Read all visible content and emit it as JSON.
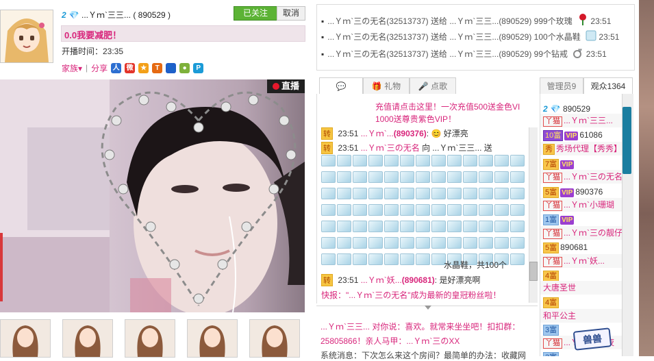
{
  "host": {
    "level_badge": "2",
    "name": "...Ｙｍ`三三...",
    "room_id": "( 890529 )",
    "follow_label": "已关注",
    "cancel_label": "取消",
    "title": "0.0我要减肥！",
    "airtime_label": "开播时间：23:35",
    "family_label": "家族▾",
    "share_label": "分享"
  },
  "video": {
    "live_label": "直播"
  },
  "gift_feed": [
    {
      "text": "...Ｙｍ`三の无名(32513737) 送给 ...Ｙｍ`三三...(890529) 999个玫瑰",
      "time": "23:51",
      "icon": "rose-icon"
    },
    {
      "text": "...Ｙｍ`三の无名(32513737) 送给 ...Ｙｍ`三三...(890529) 100个水晶鞋",
      "time": "23:51",
      "icon": "crystal-shoe-icon"
    },
    {
      "text": "...Ｙｍ`三の无名(32513737) 送给 ...Ｙｍ`三三...(890529) 99个钻戒",
      "time": "23:51",
      "icon": "diamond-ring-icon"
    }
  ],
  "tabs": {
    "gift": "礼物",
    "song": "点歌",
    "admin": "管理员9",
    "audience": "观众1364"
  },
  "chat": {
    "announce_1": "充值请点击这里！一次充值500送金色VI",
    "announce_2": "1000送尊贵紫色VIP！",
    "zhuan": "转",
    "line1_time": "23:51",
    "line1_user": "...Ｙｍ`...",
    "line1_id": "(890376)",
    "line1_msg": ": 😊 好漂亮",
    "line2_time": "23:51",
    "line2_user": "...Ｙｍ`三の无名",
    "line2_msg": "向 ...Ｙｍ`三三... 送",
    "shoes_caption": "水晶鞋，共100个",
    "line3_time": "23:51",
    "line3_user": "...Ｙｍ`妖...",
    "line3_id": "(890681)",
    "line3_msg": ": 是好漂亮啊",
    "news": "快报：\"...Ｙｍ`三の无名\"成为最新的皇冠粉丝啦！"
  },
  "private": {
    "line1": "...Ｙｍ`三三... 对你说：喜欢。就常来坐坐吧！扣扣群：",
    "line2": "25805866！亲人马甲：...Ｙｍ`三のXX",
    "line3": "系统消息：下次怎么来这个房间？最简单的办法：收藏网"
  },
  "audience": [
    {
      "badge": "2",
      "name": "890529",
      "style": "plain"
    },
    {
      "badge": "丫猫",
      "name": "...Ｙｍ`三三...",
      "style": "cat"
    },
    {
      "badge": "10富",
      "name": "61086",
      "style": "purple-vip"
    },
    {
      "badge": "秀",
      "name": "秀场代理【秀秀】",
      "style": "agent"
    },
    {
      "badge": "7富",
      "name": "",
      "style": "rich-vip"
    },
    {
      "badge": "丫猫",
      "name": "...Ｙｍ`三の无名",
      "style": "cat"
    },
    {
      "badge": "5富",
      "name": "890376",
      "style": "rich-vip"
    },
    {
      "badge": "丫猫",
      "name": "...Ｙｍ`小珊瑚",
      "style": "cat"
    },
    {
      "badge": "1富",
      "name": "",
      "style": "blue-vip"
    },
    {
      "badge": "丫猫",
      "name": "...Ｙｍ`三の靓仔",
      "style": "cat"
    },
    {
      "badge": "5富",
      "name": "890681",
      "style": "rich"
    },
    {
      "badge": "丫猫",
      "name": "...Ｙｍ`妖...",
      "style": "cat"
    },
    {
      "badge": "4富",
      "name": "",
      "style": "rich"
    },
    {
      "badge": "",
      "name": "大唐圣世",
      "style": "plain-pink"
    },
    {
      "badge": "4富",
      "name": "",
      "style": "rich"
    },
    {
      "badge": "",
      "name": "和平公主",
      "style": "plain-pink"
    },
    {
      "badge": "3富",
      "name": "",
      "style": "blue"
    },
    {
      "badge": "丫猫",
      "name": "...Ｙｍ`三の夜",
      "style": "cat"
    },
    {
      "badge": "3富",
      "name": "",
      "style": "blue"
    }
  ],
  "seal_text": "兽兽",
  "colors": {
    "accent_pink": "#d8257b",
    "follow_green": "#5cb335",
    "live_red": "#e5182c"
  }
}
